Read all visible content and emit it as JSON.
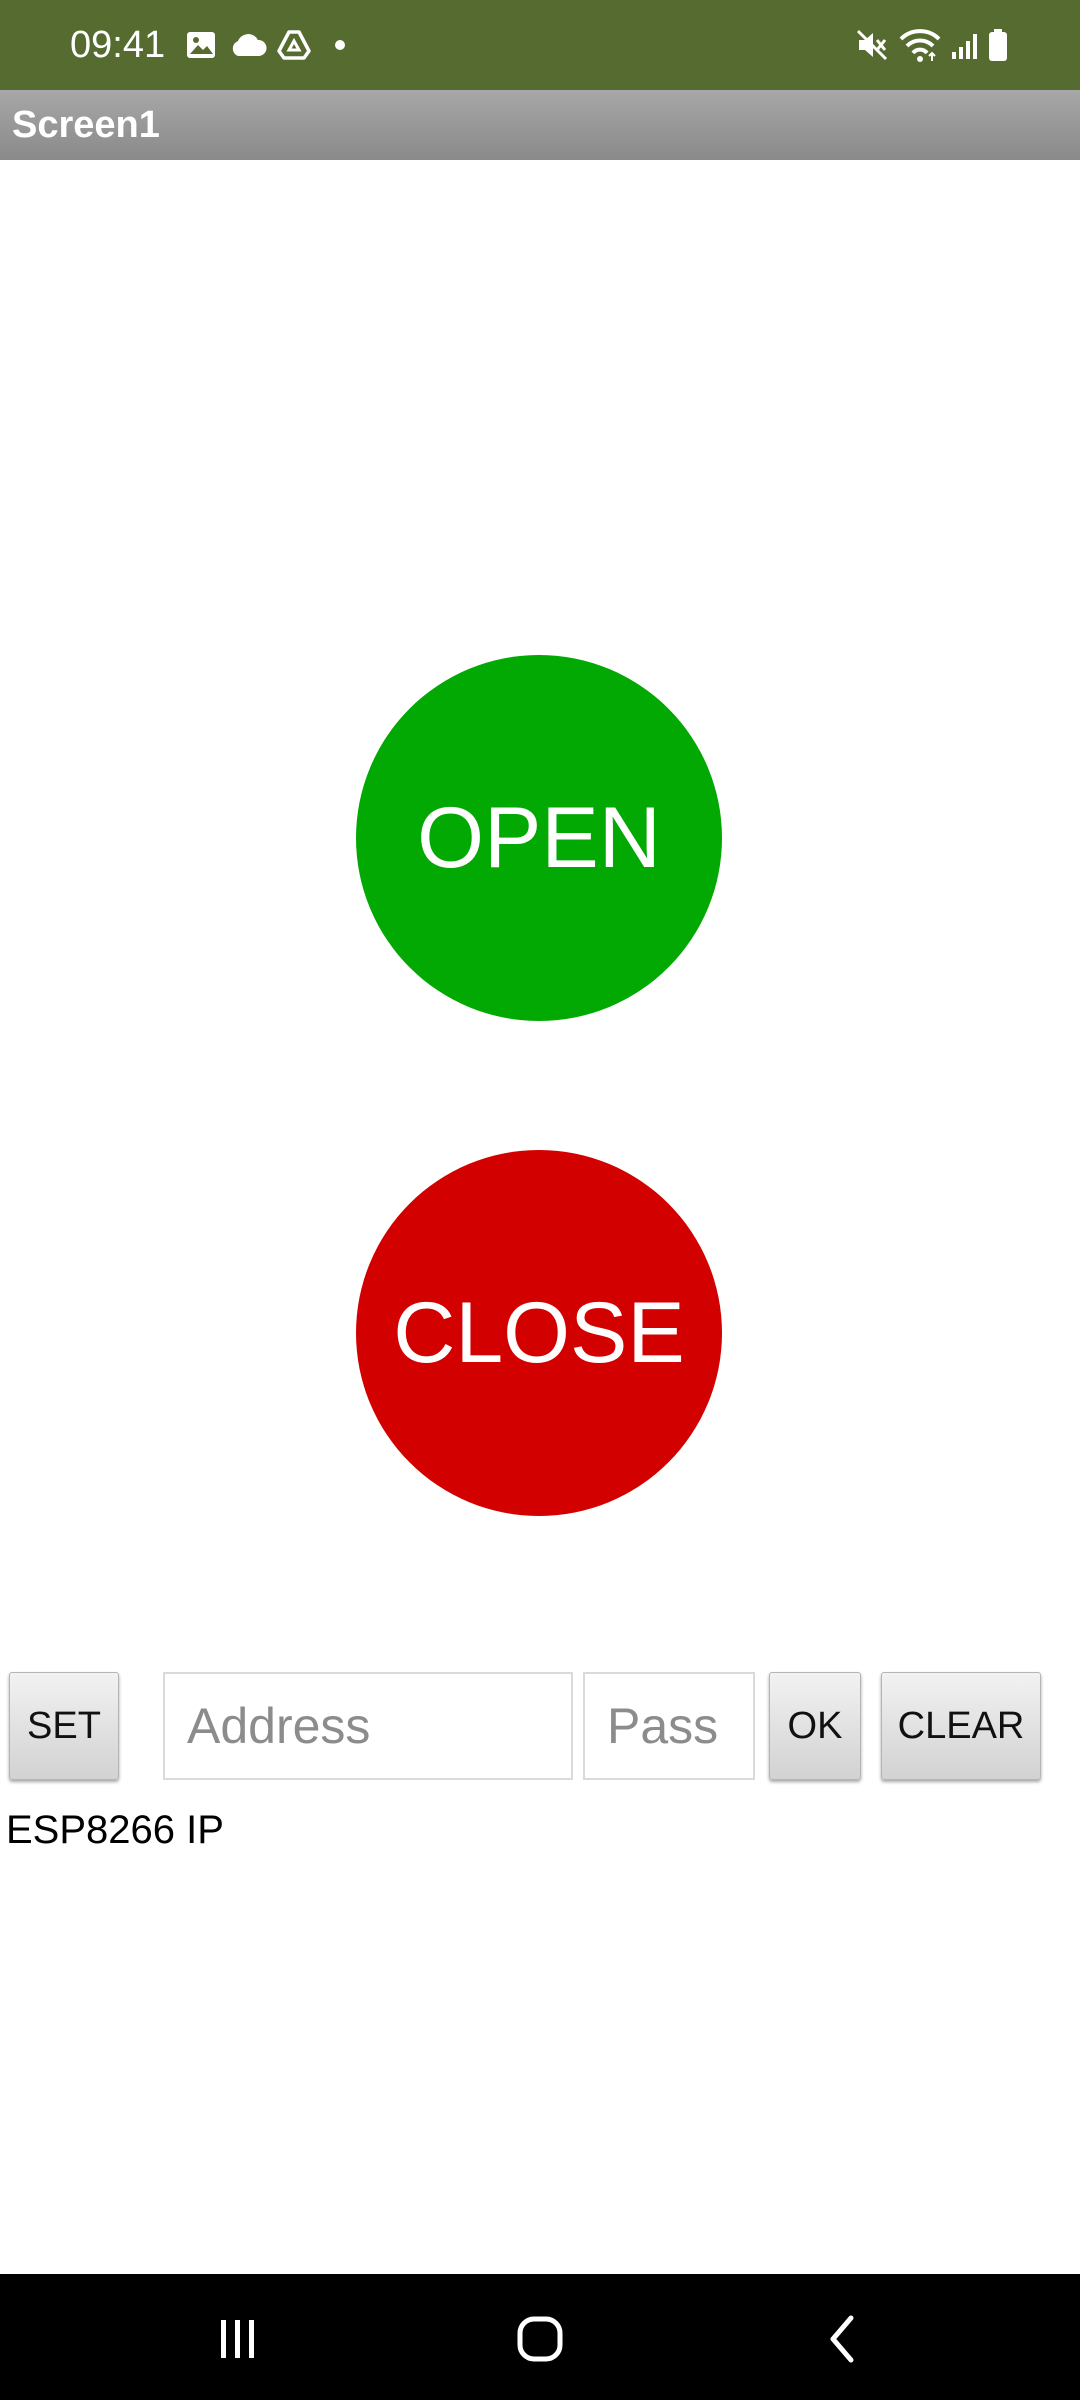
{
  "status_bar": {
    "time": "09:41",
    "left_icons": [
      "image-icon",
      "cloud-icon",
      "drive-icon",
      "dot-icon"
    ],
    "right_icons": [
      "mute-icon",
      "wifi-icon",
      "signal-icon",
      "battery-icon"
    ],
    "background": "#556b2f"
  },
  "app_bar": {
    "title": "Screen1"
  },
  "main": {
    "open_button": {
      "label": "OPEN",
      "color": "#02a902"
    },
    "close_button": {
      "label": "CLOSE",
      "color": "#d30000"
    }
  },
  "controls": {
    "set_label": "SET",
    "address_placeholder": "Address",
    "address_value": "",
    "pass_placeholder": "Pass",
    "pass_value": "",
    "ok_label": "OK",
    "clear_label": "CLEAR"
  },
  "ip_label": "ESP8266 IP",
  "nav_bar": {
    "items": [
      "recent-apps-icon",
      "home-icon",
      "back-icon"
    ]
  }
}
